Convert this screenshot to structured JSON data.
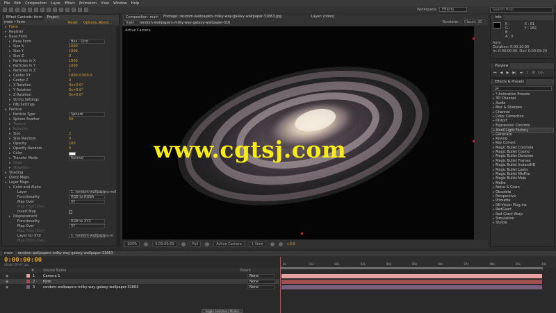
{
  "menu": [
    "File",
    "Edit",
    "Composition",
    "Layer",
    "Effect",
    "Animation",
    "View",
    "Window",
    "Help"
  ],
  "toolbar": {
    "workspace_label": "Workspace:",
    "workspace_value": "Effects",
    "search_placeholder": "Search Help"
  },
  "effect_controls": {
    "tabs": [
      "Effect Controls: form",
      "Project"
    ],
    "sub_header": "main • form",
    "reset": "Reset",
    "options": "Options...",
    "about": "About...",
    "rows": [
      {
        "name": "Form",
        "value": "",
        "indent": 1,
        "hl": true
      },
      {
        "name": "Register",
        "value": "",
        "indent": 1
      },
      {
        "name": "Base Form",
        "value": "",
        "indent": 1
      },
      {
        "name": "Base Form",
        "value": "Box - Grid",
        "indent": 2,
        "dd": true
      },
      {
        "name": "Size X",
        "value": "1000",
        "indent": 2
      },
      {
        "name": "Size Y",
        "value": "1000",
        "indent": 2
      },
      {
        "name": "Size Z",
        "value": "0",
        "indent": 2
      },
      {
        "name": "Particles in X",
        "value": "1000",
        "indent": 2
      },
      {
        "name": "Particles in Y",
        "value": "1000",
        "indent": 2
      },
      {
        "name": "Particles in Z",
        "value": "1",
        "indent": 2
      },
      {
        "name": "Center XY",
        "value": "1000.0,500.0",
        "indent": 2
      },
      {
        "name": "Center Z",
        "value": "0",
        "indent": 2
      },
      {
        "name": "X Rotation",
        "value": "0x+0.0°",
        "indent": 2
      },
      {
        "name": "Y Rotation",
        "value": "0x+0.0°",
        "indent": 2
      },
      {
        "name": "Z Rotation",
        "value": "0x+0.0°",
        "indent": 2
      },
      {
        "name": "String Settings",
        "value": "",
        "indent": 2
      },
      {
        "name": "OBJ Settings",
        "value": "",
        "indent": 2
      },
      {
        "name": "Particle",
        "value": "",
        "indent": 1
      },
      {
        "name": "Particle Type",
        "value": "Sphere",
        "indent": 2,
        "dd": true
      },
      {
        "name": "Sphere Feather",
        "value": "50",
        "indent": 2
      },
      {
        "name": "Texture",
        "value": "",
        "indent": 2,
        "dim": true
      },
      {
        "name": "Rotation",
        "value": "",
        "indent": 2,
        "dim": true
      },
      {
        "name": "Size",
        "value": "2",
        "indent": 2
      },
      {
        "name": "Size Random",
        "value": "0",
        "indent": 2
      },
      {
        "name": "Opacity",
        "value": "100",
        "indent": 2
      },
      {
        "name": "Opacity Random",
        "value": "0",
        "indent": 2
      },
      {
        "name": "Color",
        "value": "",
        "indent": 2,
        "swatch": true
      },
      {
        "name": "Transfer Mode",
        "value": "Normal",
        "indent": 2,
        "dd": true
      },
      {
        "name": "Glow",
        "value": "",
        "indent": 2,
        "dim": true
      },
      {
        "name": "Streaklet",
        "value": "",
        "indent": 2,
        "dim": true
      },
      {
        "name": "Shading",
        "value": "",
        "indent": 1
      },
      {
        "name": "Quick Maps",
        "value": "",
        "indent": 1
      },
      {
        "name": "Layer Maps",
        "value": "",
        "indent": 1
      },
      {
        "name": "Color and Alpha",
        "value": "",
        "indent": 2
      },
      {
        "name": "Layer",
        "value": "1. random-wallpapers-milk",
        "indent": 3,
        "dd": true
      },
      {
        "name": "Functionality",
        "value": "RGB to RGBA",
        "indent": 3,
        "dd": true
      },
      {
        "name": "Map Over",
        "value": "XY",
        "indent": 3,
        "dd": true
      },
      {
        "name": "Map Time [Out]",
        "value": "",
        "indent": 3,
        "dim": true
      },
      {
        "name": "Invert Map",
        "value": "",
        "indent": 3,
        "check": true
      },
      {
        "name": "Displacement",
        "value": "",
        "indent": 2
      },
      {
        "name": "Functionality",
        "value": "RGB to XYZ",
        "indent": 3,
        "dd": true
      },
      {
        "name": "Map Over",
        "value": "XY",
        "indent": 3,
        "dd": true
      },
      {
        "name": "Map Time [Out]",
        "value": "",
        "indent": 3,
        "dim": true
      },
      {
        "name": "Layer for XYZ",
        "value": "1. random-wallpapers-m",
        "indent": 3,
        "dd": true
      },
      {
        "name": "Map Time [Out]",
        "value": "",
        "indent": 3,
        "dim": true
      }
    ]
  },
  "composition": {
    "tabs": [
      "Composition: main"
    ],
    "footage_tab": "Footage: random-wallpapers-milky-way-galaxy-wallpaper-31663.jpg",
    "layer_tab": "Layer: (none)",
    "breadcrumb": [
      "main",
      "random-wallpapers-milky-way-galaxy-wallpaper-316"
    ],
    "renderer_label": "Renderer:",
    "renderer_value": "Classic 3D",
    "view_label": "Active Camera",
    "watermark": "www.cgtsj.com",
    "footer": {
      "zoom": "100%",
      "timecode": "0:00:00:00",
      "resolution": "Full",
      "camera": "Active Camera",
      "views": "1 View",
      "exposure": "+0.0"
    }
  },
  "info": {
    "title": "Info",
    "r": "R :",
    "g": "G :",
    "b": "B :",
    "a": "A : 0",
    "x": "X : 81",
    "y": "Y : 182",
    "layer": "form",
    "duration": "Duration: 0:00:10:00",
    "in_out": "In: 0:00:00:00, Out: 0:00:09:29"
  },
  "preview": {
    "title": "Preview"
  },
  "effects_presets": {
    "title": "Effects & Presets",
    "search_placeholder": "ρ▾",
    "items": [
      "* Animation Presets",
      "3D Channel",
      "Audio",
      "Blur & Sharpen",
      "Channel",
      "Color Correction",
      "Distort",
      "Expression Controls",
      "Knoll Light Factory",
      "Generate",
      "Keying",
      "Key Correct",
      "Magic Bullet Colorista",
      "Magic Bullet Cosmo",
      "Magic Bullet Denoiser",
      "Magic Bullet Frames",
      "Magic Bullet InstantHD",
      "Magic Bullet Looks",
      "Magic Bullet MisFire",
      "Magic Bullet Mojo",
      "Matte",
      "Noise & Grain",
      "Obsolete",
      "Perspective",
      "Primatte",
      "RE:Vision Plug-ins",
      "RedGiant",
      "Red Giant Warp",
      "Simulation",
      "Stylize"
    ]
  },
  "timeline": {
    "tabs": [
      "main",
      "random-wallpapers-milky-way-galaxy-wallpaper-31663"
    ],
    "timecode": "0:00:00:00",
    "frames": "00000 (29.97 fps)",
    "col_headers": [
      "#",
      "Source Name",
      "Parent"
    ],
    "layers": [
      {
        "num": "1",
        "name": "Camera 1",
        "parent": "None",
        "color": "#e8a0a0"
      },
      {
        "num": "2",
        "name": "form",
        "parent": "None",
        "color": "#a05050"
      },
      {
        "num": "3",
        "name": "random-wallpapers-milky-way-galaxy-wallpaper-31663",
        "parent": "None",
        "color": "#7a6080"
      }
    ],
    "ticks": [
      "0s",
      "01s",
      "02s",
      "03s",
      "04s",
      "05s",
      "06s",
      "07s",
      "08s",
      "09s",
      "10s"
    ],
    "toggle": "Toggle Switches / Modes"
  }
}
